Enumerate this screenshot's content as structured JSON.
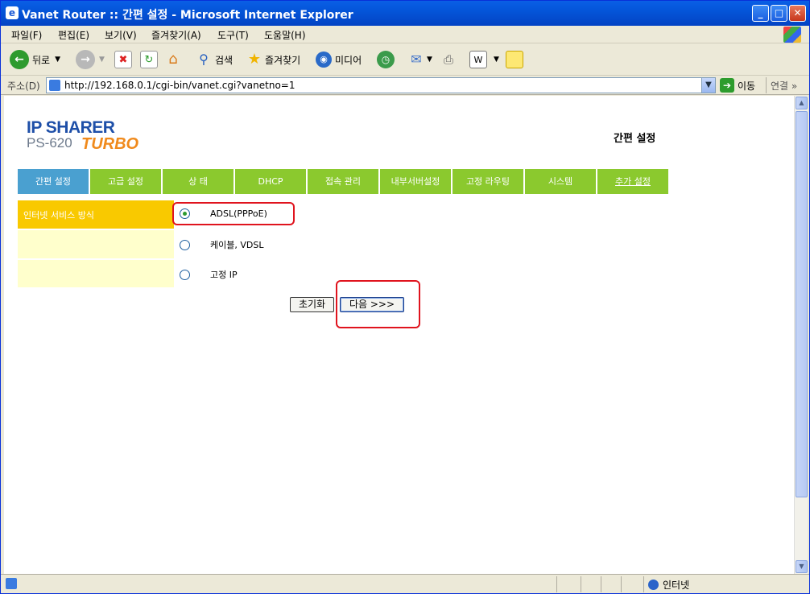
{
  "window": {
    "title": "Vanet Router :: 간편 설정 - Microsoft Internet Explorer"
  },
  "menu": [
    "파일(F)",
    "편집(E)",
    "보기(V)",
    "즐겨찾기(A)",
    "도구(T)",
    "도움말(H)"
  ],
  "toolbar": {
    "back": "뒤로",
    "search": "검색",
    "favorites": "즐겨찾기",
    "media": "미디어"
  },
  "address": {
    "label": "주소(D)",
    "url": "http://192.168.0.1/cgi-bin/vanet.cgi?vanetno=1",
    "go": "이동",
    "links": "연결"
  },
  "page": {
    "logo_line1": "IP SHARER",
    "logo_line2": "PS-620",
    "logo_line3": "TURBO",
    "title": "간편 설정",
    "tabs": [
      "간편 설정",
      "고급 설정",
      "상 태",
      "DHCP",
      "접속 관리",
      "내부서버설정",
      "고정 라우팅",
      "시스템",
      "추가 설정"
    ],
    "section_label": "인터넷 서비스 방식",
    "options": [
      "ADSL(PPPoE)",
      "케이블, VDSL",
      "고정 IP"
    ],
    "selected_option": "ADSL(PPPoE)",
    "reset_button": "초기화",
    "next_button": "다음 >>>"
  },
  "status": {
    "zone": "인터넷"
  }
}
